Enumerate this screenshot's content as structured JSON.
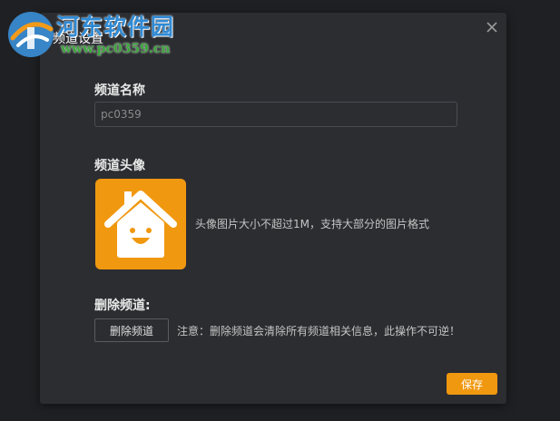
{
  "watermark": {
    "site_name": "河东软件园",
    "site_url": "www.pc0359.cn"
  },
  "dialog": {
    "title": "频道设置",
    "close_icon": "close-icon"
  },
  "channel_name": {
    "label": "频道名称",
    "placeholder": "pc0359",
    "value": ""
  },
  "avatar": {
    "label": "频道头像",
    "icon": "house-smile-icon",
    "hint": "头像图片大小不超过1M，支持大部分的图片格式",
    "color": "#f0980f"
  },
  "delete_channel": {
    "label": "删除频道:",
    "button_label": "删除频道",
    "notice": "注意：删除频道会清除所有频道相关信息，此操作不可逆！"
  },
  "footer": {
    "save_label": "保存"
  }
}
